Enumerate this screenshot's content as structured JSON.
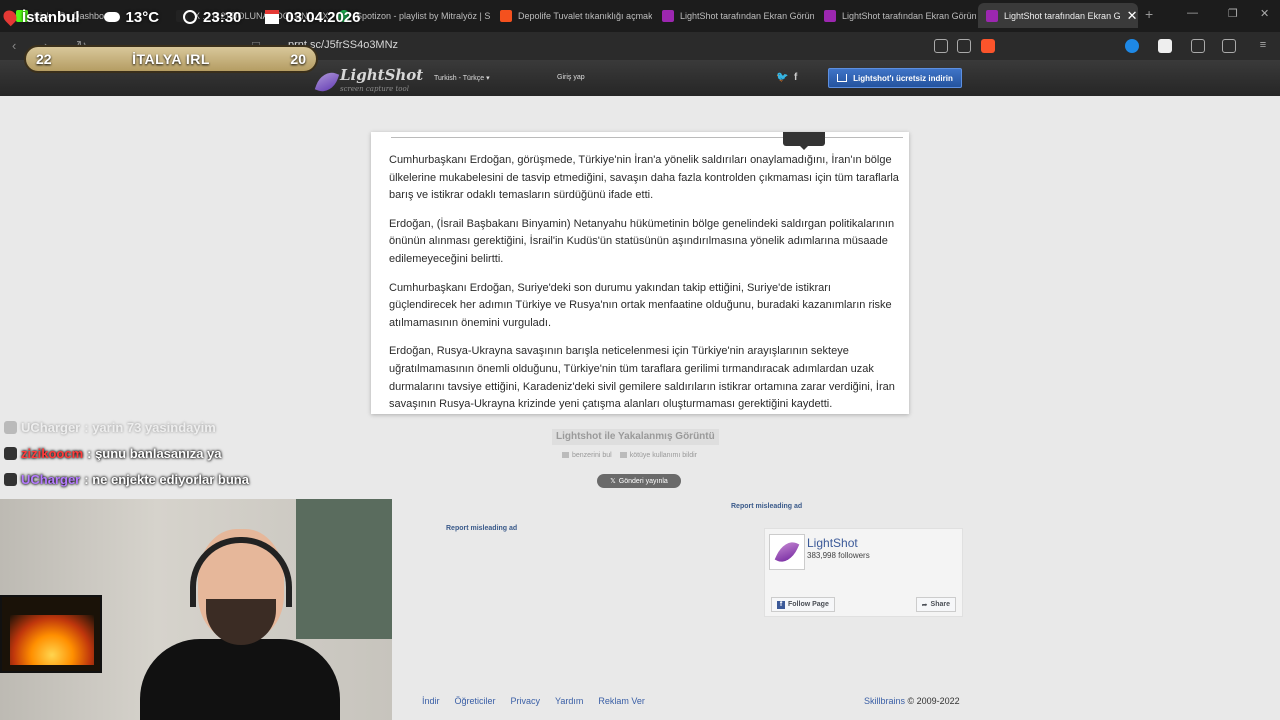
{
  "browser": {
    "tabs": [
      {
        "label": "Kick - Ru Dashboard",
        "color": "#53fc18"
      },
      {
        "label": "X ... (12) DOLUNAY DOLUN... | X",
        "color": "#222222"
      },
      {
        "label": "Spotizon - playlist by Mitralyöz | Spo",
        "color": "#1db954"
      },
      {
        "label": "Depolife Tuvalet tıkanıklığı açmak ta",
        "color": "#f4511e"
      },
      {
        "label": "LightShot tarafından Ekran Görüntüs",
        "color": "#9c27b0"
      },
      {
        "label": "LightShot tarafından Ekran Görüntüs",
        "color": "#9c27b0"
      },
      {
        "label": "LightShot tarafından Ekran G",
        "color": "#9c27b0"
      }
    ],
    "url": "prnt.sc/J5frSS4o3MNz"
  },
  "overlay": {
    "city": "İstanbul",
    "temp": "13°C",
    "time": "23:30",
    "date": "03.04.2026",
    "score_left": "22",
    "team": "İTALYA IRL",
    "score_right": "20",
    "chat": [
      {
        "user": "UCharger",
        "msg": " : yarin 73 yasindayim",
        "color": "#ffffff"
      },
      {
        "user": "zizikoocm",
        "msg": " : şunu banlasanıza ya",
        "color": "#ff3b3b"
      },
      {
        "user": "UCharger",
        "msg": " : ne enjekte ediyorlar buna",
        "color": "#b57bff"
      }
    ]
  },
  "lightshot": {
    "logo": "LightShot",
    "tagline": "screen capture tool",
    "language": "Turkish - Türkçe",
    "login": "Giriş yap",
    "download": "Lightshot'ı ücretsiz indirin",
    "paragraphs": [
      "Cumhurbaşkanı Erdoğan, görüşmede, Türkiye'nin İran'a yönelik saldırıları onaylamadığını, İran'ın bölge ülkelerine mukabelesini de tasvip etmediğini, savaşın daha fazla kontrolden çıkmaması için tüm taraflarla barış ve istikrar odaklı temasların sürdüğünü ifade etti.",
      "Erdoğan, (İsrail Başbakanı Binyamin) Netanyahu hükümetinin bölge genelindeki saldırgan politikalarının önünün alınması gerektiğini, İsrail'in Kudüs'ün statüsünün aşındırılmasına yönelik adımlarına müsaade edilemeyeceğini belirtti.",
      "Cumhurbaşkanı Erdoğan, Suriye'deki son durumu yakından takip ettiğini, Suriye'de istikrarı güçlendirecek her adımın Türkiye ve Rusya'nın ortak menfaatine olduğunu, buradaki kazanımların riske atılmamasının önemini vurguladı.",
      "Erdoğan, Rusya-Ukrayna savaşının barışla neticelenmesi için Türkiye'nin arayışlarının sekteye uğratılmamasının önemli olduğunu, Türkiye'nin tüm taraflara gerilimi tırmandıracak adımlardan uzak durmalarını tavsiye ettiğini, Karadeniz'deki sivil gemilere saldırıların istikrar ortamına zarar verdiğini, İran savaşının Rusya-Ukrayna krizinde yeni çatışma alanları oluşturmaması gerektiğini kaydetti."
    ],
    "caption": "Lightshot ile Yakalanmış Görüntü",
    "find_similar": "benzerini bul",
    "report_abuse": "kötüye kullanımı bildir",
    "tweet": "Gönderi yayınla",
    "report_ad_1": "Report misleading ad",
    "report_ad_2": "Report misleading ad",
    "fb": {
      "page": "LightShot",
      "followers": "383,998 followers",
      "follow": "Follow Page",
      "share": "Share"
    },
    "footer": [
      "İndir",
      "Öğreticiler",
      "Privacy",
      "Yardım",
      "Reklam Ver"
    ],
    "brand": "Skillbrains",
    "copyright": " © 2009-2022"
  }
}
